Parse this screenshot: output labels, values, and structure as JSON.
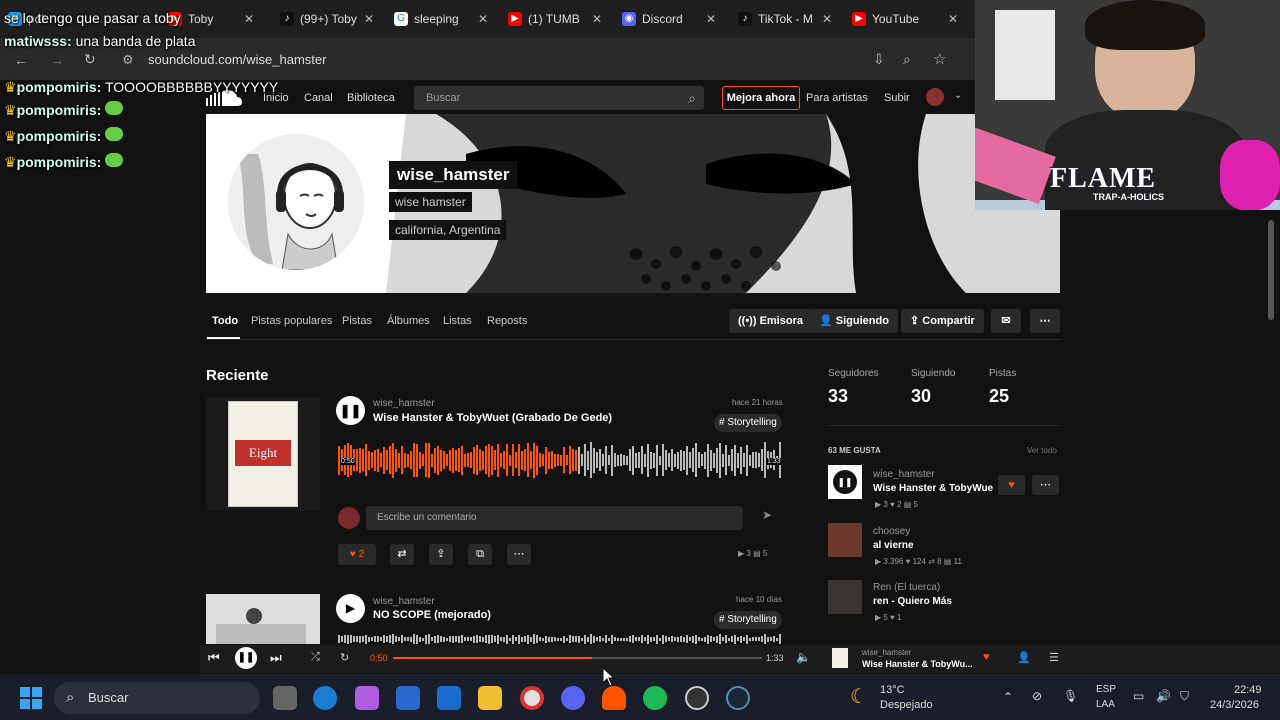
{
  "browser": {
    "tabs": [
      {
        "label": "pol",
        "icon": "x-icon"
      },
      {
        "label": "Toby",
        "icon": "youtube-icon"
      },
      {
        "label": "(99+) Toby",
        "icon": "tiktok-icon"
      },
      {
        "label": "sleeping",
        "icon": "google-icon"
      },
      {
        "label": "(1) TUMB",
        "icon": "youtube-icon"
      },
      {
        "label": "Discord",
        "icon": "discord-icon"
      },
      {
        "label": "TikTok - M",
        "icon": "tiktok-icon"
      },
      {
        "label": "YouTube",
        "icon": "youtube-icon"
      }
    ],
    "url": "soundcloud.com/wise_hamster"
  },
  "chat": [
    {
      "user": "",
      "text": "se lo tengo que pasar a toby"
    },
    {
      "user": "matiwsss:",
      "text": "una banda de plata"
    },
    {
      "user": "pompomiris:",
      "text": "TOOOOBBBBBBYYYYYYY"
    },
    {
      "user": "pompomiris:",
      "text": ""
    },
    {
      "user": "pompomiris:",
      "text": ""
    },
    {
      "user": "pompomiris:",
      "text": ""
    }
  ],
  "nav": {
    "links": [
      "Inicio",
      "Canal",
      "Biblioteca"
    ],
    "search_placeholder": "Buscar",
    "upgrade": "Mejora ahora",
    "artists": "Para artistas",
    "upload": "Subir"
  },
  "profile": {
    "username": "wise_hamster",
    "display_name": "wise hamster",
    "location": "california, Argentina"
  },
  "profile_tabs": [
    "Todo",
    "Pistas populares",
    "Pistas",
    "Álbumes",
    "Listas",
    "Reposts"
  ],
  "actions": {
    "station": "Emisora",
    "following": "Siguiendo",
    "share": "Compartir"
  },
  "section_title": "Reciente",
  "tracks": [
    {
      "artist": "wise_hamster",
      "title": "Wise Hanster & TobyWuet (Grabado De Gede)",
      "time": "hace 21 horas",
      "tag": "# Storytelling",
      "likes": "2",
      "plays": "3",
      "comments": "5",
      "elapsed": "0:50",
      "duration": "1:33",
      "comment_placeholder": "Escribe un comentario",
      "cover_text": "Eight"
    },
    {
      "artist": "wise_hamster",
      "title": "NO SCOPE (mejorado)",
      "time": "hace 10 días",
      "tag": "# Storytelling"
    }
  ],
  "stats": {
    "followers_label": "Seguidores",
    "followers": "33",
    "following_label": "Siguiendo",
    "following": "30",
    "tracks_label": "Pistas",
    "tracks": "25"
  },
  "likes": {
    "header": "63 ME GUSTA",
    "view_all": "Ver todo",
    "items": [
      {
        "artist": "wise_hamster",
        "title": "Wise Hanster & TobyWuet (",
        "s1": "3",
        "s2": "2",
        "s3": "5"
      },
      {
        "artist": "choosey",
        "title": "al vierne",
        "s1": "3.396",
        "s2": "124",
        "s3": "8",
        "s4": "11"
      },
      {
        "artist": "Ren (El tuerca)",
        "title": "ren - Quiero Más",
        "s1": "5",
        "s2": "1"
      }
    ]
  },
  "player": {
    "elapsed": "0:50",
    "duration": "1:33",
    "progress": 0.54,
    "artist": "wise_hamster",
    "title": "Wise Hanster & TobyWu..."
  },
  "stream": {
    "brand": "FLAME",
    "sub": "TRAP-A-HOLICS"
  },
  "taskbar": {
    "search": "Buscar",
    "weather_temp": "13°C",
    "weather_desc": "Despejado",
    "lang1": "ESP",
    "lang2": "LAA",
    "time": "22:49",
    "date": "24/3/2026"
  },
  "colors": {
    "accent": "#ff5500",
    "bg": "#121212"
  }
}
